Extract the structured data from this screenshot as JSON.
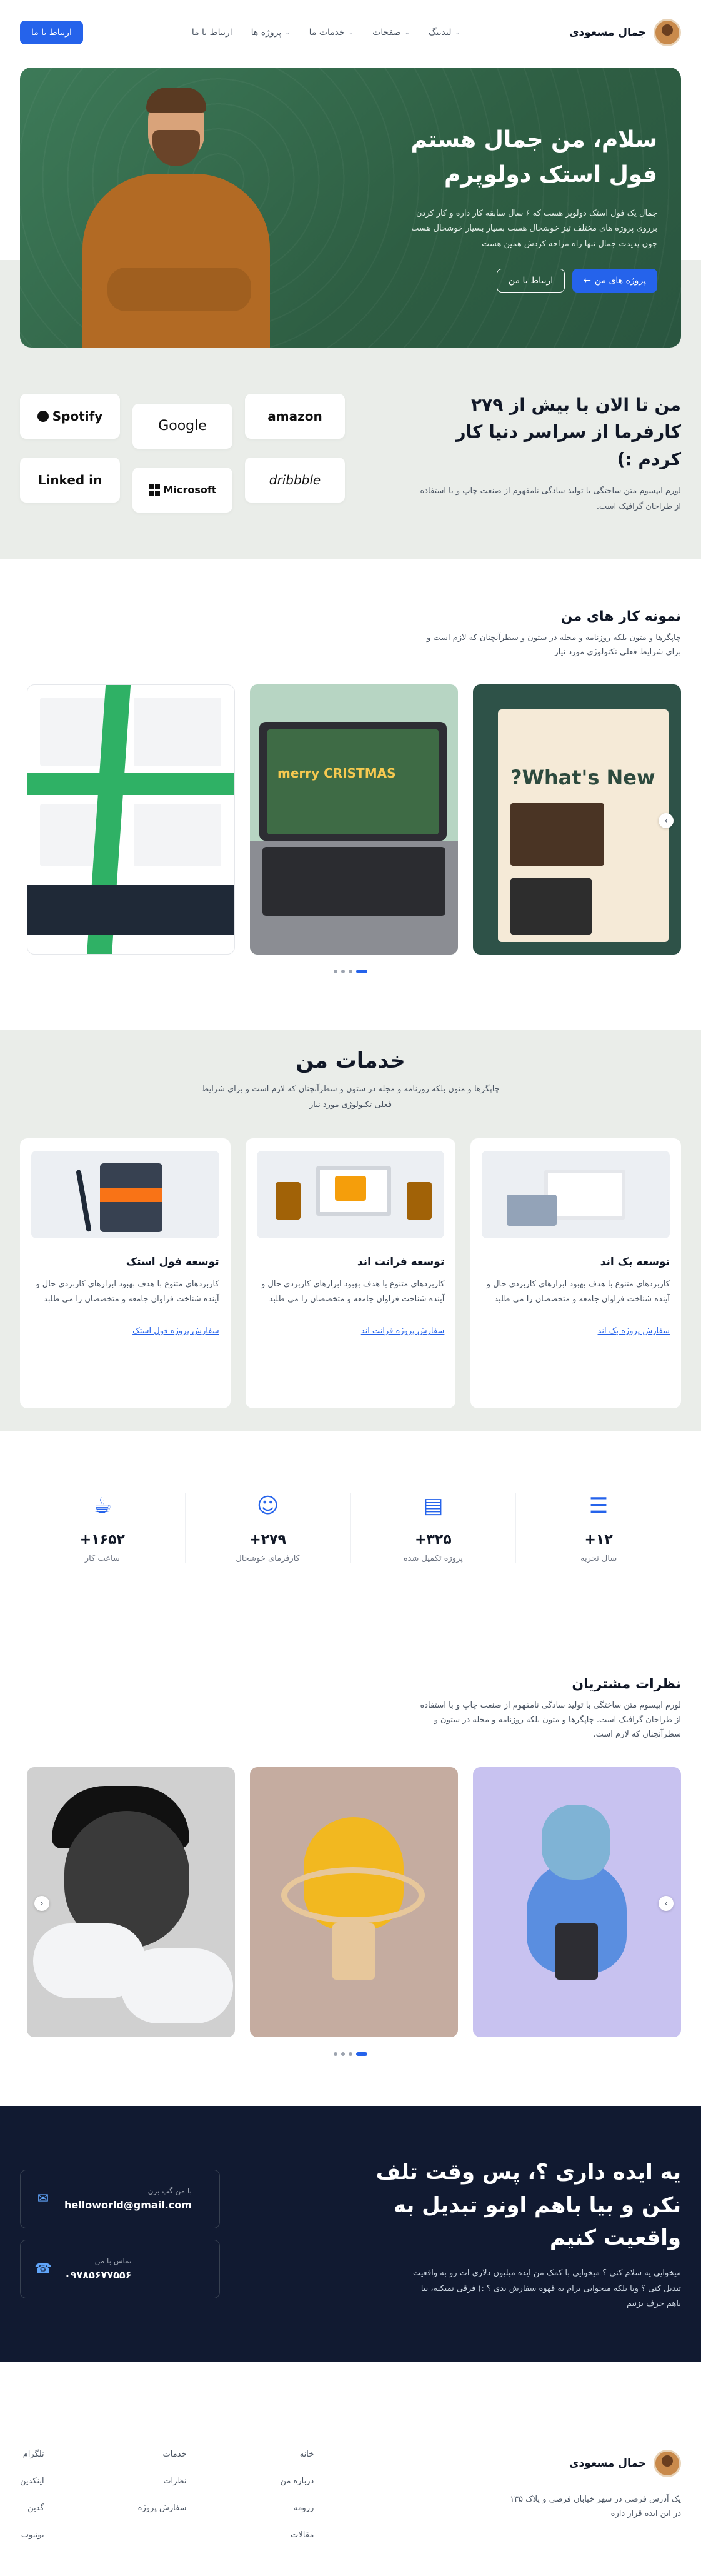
{
  "header": {
    "brand": "جمال مسعودی",
    "nav": [
      {
        "label": "لندینگ",
        "has_menu": true
      },
      {
        "label": "صفحات",
        "has_menu": true
      },
      {
        "label": "خدمات ما",
        "has_menu": true
      },
      {
        "label": "پروژه ها",
        "has_menu": true
      },
      {
        "label": "ارتباط با ما",
        "has_menu": false
      }
    ],
    "cta": "ارتباط با ما"
  },
  "hero": {
    "title_line1": "سلام، من جمال هستم",
    "title_line2": "فول استک دولوپرم",
    "description": "جمال یک فول استک دولوپر هست که ۶ سال سابقه کار داره و کار کردن برروی پروژه های مختلف تیز خوشحال هست بسیار بسیار خوشحال هست چون پدیدت جمال تنها راه مراحه کردش همین هست",
    "primary_button": "پروژه های من",
    "secondary_button": "ارتباط با من"
  },
  "clients": {
    "title": "من تا الان با بیش از ۲۷۹ کارفرما از سراسر دنیا کار کردم :)",
    "description": "لورم ایپسوم متن ساختگی با تولید سادگی نامفهوم از صنعت چاپ و با استفاده از طراحان گرافیک است.",
    "logos": [
      "amazon",
      "Google",
      "Spotify",
      "dribbble",
      "Microsoft",
      "Linked in"
    ]
  },
  "portfolio": {
    "title": "نمونه کار های من",
    "description": "چاپگرها و متون بلکه روزنامه و مجله در ستون و سطرآنچنان که لازم است و برای شرایط فعلی تکنولوژی مورد نیاز",
    "slides": [
      {
        "headline": "What's New?"
      },
      {
        "headline": "merry CRISTMAS"
      },
      {
        "headline": ""
      }
    ]
  },
  "services": {
    "title": "خدمات من",
    "description": "چاپگرها و متون بلکه روزنامه و مجله در ستون و سطرآنچنان که لازم است و برای شرایط فعلی تکنولوژی مورد نیاز",
    "items": [
      {
        "title": "توسعه بک اند",
        "description": "کاربردهای متنوع با هدف بهبود ابزارهای کاربردی حال و آینده شناخت فراوان جامعه و متخصصان را می طلبد",
        "link": "سفارش پروژه بک اند"
      },
      {
        "title": "توسعه فرانت اند",
        "description": "کاربردهای متنوع با هدف بهبود ابزارهای کاربردی حال و آینده شناخت فراوان جامعه و متخصصان را می طلبد",
        "link": "سفارش پروژه فرانت اند"
      },
      {
        "title": "توسعه فول استک",
        "description": "کاربردهای متنوع با هدف بهبود ابزارهای کاربردی حال و آینده شناخت فراوان جامعه و متخصصان را می طلبد",
        "link": "سفارش پروژه فول استک"
      }
    ]
  },
  "stats": [
    {
      "icon": "layers-icon",
      "value": "۱۲+",
      "label": "سال تجربه"
    },
    {
      "icon": "briefcase-icon",
      "value": "۳۲۵+",
      "label": "پروژه تکمیل شده"
    },
    {
      "icon": "smile-icon",
      "value": "۲۷۹+",
      "label": "کارفرمای خوشحال"
    },
    {
      "icon": "coffee-icon",
      "value": "۱۶۵۲+",
      "label": "ساعت کار"
    }
  ],
  "testimonials": {
    "title": "نظرات مشتریان",
    "description": "لورم ایپسوم متن ساختگی با تولید سادگی نامفهوم از صنعت چاپ و با استفاده از طراحان گرافیک است. چاپگرها و متون بلکه روزنامه و مجله در ستون و سطرآنچنان که لازم است."
  },
  "cta": {
    "title": "یه ایده داری ؟، پس وقت تلف نکن و بیا باهم اونو تبدیل به واقعیت کنیم",
    "description": "میخوایی یه سلام کنی ؟ میخوایی با کمک من ایده میلیون دلاری ات رو به واقعیت تبدیل کنی ؟ ویا بلکه میخوایی برام یه قهوه سفارش بدی ؟ :) فرقی نمیکنه، بیا باهم حرف بزنیم",
    "email_label": "با من گپ بزن",
    "email": "helloworld@gmail.com",
    "phone_label": "تماس با من",
    "phone": "۰۹۷۸۵۶۷۷۵۵۶"
  },
  "footer": {
    "brand": "جمال مسعودی",
    "address": "یک آدرس فرضی در شهر خیابان فرضی و پلاک ۱۳۵ در این ایده قرار داره",
    "col1": [
      "خانه",
      "درباره من",
      "رزومه",
      "مقالات"
    ],
    "col2": [
      "خدمات",
      "نظرات",
      "سفارش پروژه"
    ],
    "col3": [
      "تلگرام",
      "اینکدین",
      "گدین",
      "یوتیوب"
    ]
  },
  "colors": {
    "accent": "#2563eb",
    "hero_green": "#2e5e43",
    "section_gray": "#eaede9",
    "cta_navy": "#111a31"
  }
}
